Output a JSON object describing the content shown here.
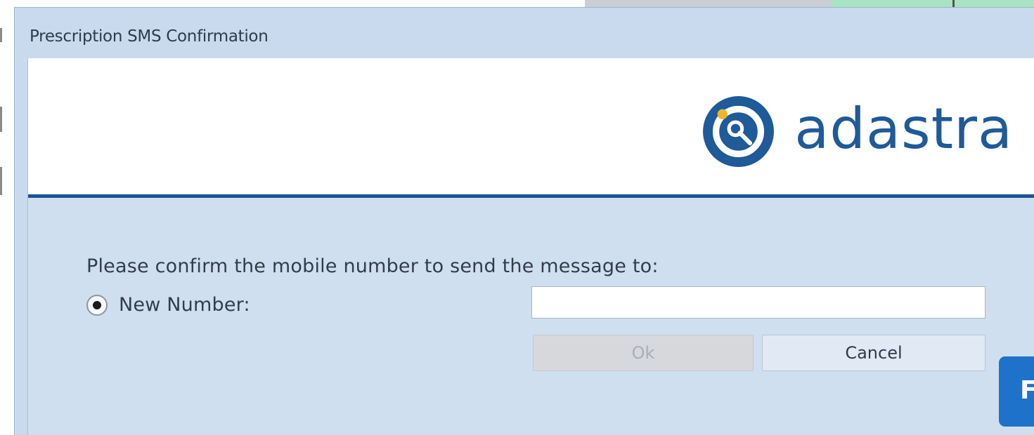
{
  "dialog": {
    "title": "Prescription SMS Confirmation",
    "brand": {
      "name": "adastra",
      "icon": "adastra-logo-icon",
      "brand_color": "#1f5a99",
      "accent_dot_color": "#f0b42a"
    },
    "prompt": "Please confirm the mobile number to send the message to:",
    "new_number": {
      "label": "New Number:",
      "selected": true,
      "input_value": "",
      "input_placeholder": ""
    },
    "buttons": {
      "ok_label": "Ok",
      "ok_enabled": false,
      "cancel_label": "Cancel"
    }
  },
  "background": {
    "blue_button_label_fragment": "F"
  }
}
